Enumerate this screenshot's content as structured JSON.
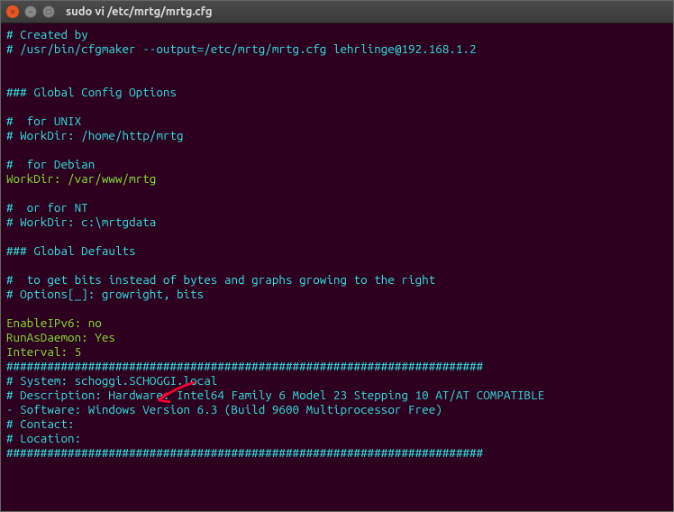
{
  "window": {
    "title": "sudo vi /etc/mrtg/mrtg.cfg"
  },
  "file": {
    "l1": "# Created by",
    "l2": "# /usr/bin/cfgmaker --output=/etc/mrtg/mrtg.cfg lehrlinge@192.168.1.2",
    "l3": "",
    "l4": "",
    "l5": "### Global Config Options",
    "l6": "",
    "l7": "#  for UNIX",
    "l8": "# WorkDir: /home/http/mrtg",
    "l9": "",
    "l10": "#  for Debian",
    "l11": "WorkDir: /var/www/mrtg",
    "l12": "",
    "l13": "#  or for NT",
    "l14": "# WorkDir: c:\\mrtgdata",
    "l15": "",
    "l16": "### Global Defaults",
    "l17": "",
    "l18": "#  to get bits instead of bytes and graphs growing to the right",
    "l19": "# Options[_]: growright, bits",
    "l20": "",
    "l21": "EnableIPv6: no",
    "l22": "RunAsDaemon: Yes",
    "l23": "Interval: 5",
    "l24": "######################################################################",
    "l25": "# System: schoggi.SCHOGGI.local",
    "l26": "# Description: Hardware: Intel64 Family 6 Model 23 Stepping 10 AT/AT COMPATIBLE",
    "l27": "- Software: Windows Version 6.3 (Build 9600 Multiprocessor Free)",
    "l28": "# Contact:",
    "l29": "# Location:",
    "l30": "######################################################################"
  },
  "annotation": {
    "arrow_color": "#ff0033"
  }
}
